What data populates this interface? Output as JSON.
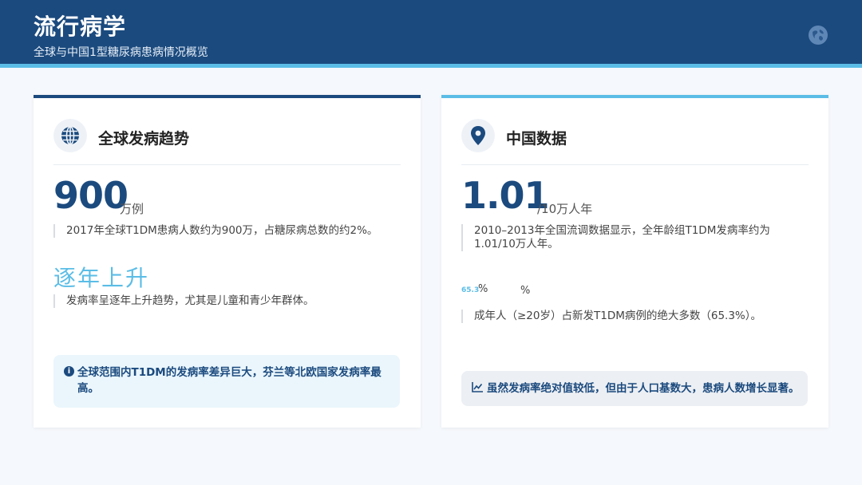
{
  "header": {
    "title": "流行病学",
    "subtitle": "全球与中国1型糖尿病患病情况概览"
  },
  "colors": {
    "primary": "#1b4a7e",
    "accent": "#5bbde6"
  },
  "global_card": {
    "icon": "globe-icon",
    "title": "全球发病趋势",
    "stat_value": "900",
    "stat_unit": "万例",
    "stat_note": "2017年全球T1DM患病人数约为900万，占糖尿病总数的约2%。",
    "trend_value": "逐年上升",
    "trend_note": "发病率呈逐年上升趋势，尤其是儿童和青少年群体。",
    "callout_icon": "info-icon",
    "callout_text": "全球范围内T1DM的发病率差异巨大，芬兰等北欧国家发病率最高。"
  },
  "china_card": {
    "icon": "map-pin-icon",
    "title": "中国数据",
    "stat_value": "1.01",
    "stat_unit": "/10万人年",
    "stat_note": "2010–2013年全国流调数据显示，全年龄组T1DM发病率约为1.01/10万人年。",
    "pct_value": "65.3",
    "pct_sign_a": "%",
    "pct_sign_b": "%",
    "pct_note": "成年人（≥20岁）占新发T1DM病例的绝大多数（65.3%）。",
    "callout_icon": "chart-line-icon",
    "callout_text": "虽然发病率绝对值较低，但由于人口基数大，患病人数增长显著。"
  }
}
